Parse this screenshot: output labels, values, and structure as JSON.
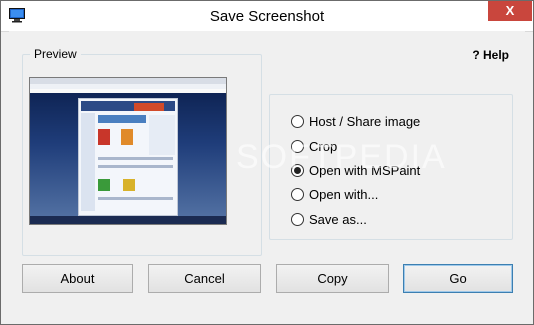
{
  "window": {
    "title": "Save Screenshot",
    "close_label": "X"
  },
  "preview": {
    "label": "Preview"
  },
  "help": {
    "label": "? Help"
  },
  "options": [
    {
      "label": "Host / Share image",
      "selected": false
    },
    {
      "label": "Crop",
      "selected": false
    },
    {
      "label": "Open with MSPaint",
      "selected": true
    },
    {
      "label": "Open with...",
      "selected": false
    },
    {
      "label": "Save as...",
      "selected": false
    }
  ],
  "buttons": {
    "about": "About",
    "cancel": "Cancel",
    "copy": "Copy",
    "go": "Go"
  },
  "watermark": "SOFTPEDIA",
  "colors": {
    "close_bg": "#c9463d",
    "preview_bg": "#1f3d7a",
    "default_button_border": "#3c7fb1"
  }
}
